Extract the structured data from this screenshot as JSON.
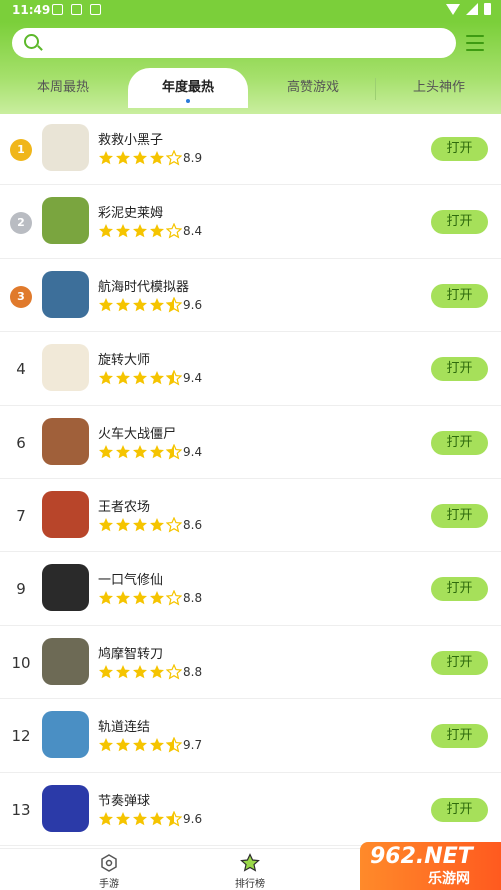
{
  "status_bar": {
    "time": "11:49"
  },
  "search": {
    "placeholder": "",
    "value": ""
  },
  "tabs": [
    {
      "label": "本周最热",
      "active": false
    },
    {
      "label": "年度最热",
      "active": true
    },
    {
      "label": "高赞游戏",
      "active": false
    },
    {
      "label": "上头神作",
      "active": false
    }
  ],
  "games": [
    {
      "rank": "1",
      "medal": "gold",
      "name": "救救小黑子",
      "score": "8.9",
      "stars": 4,
      "button": "打开",
      "icon_color": "#e9e4d6"
    },
    {
      "rank": "2",
      "medal": "silver",
      "name": "彩泥史莱姆",
      "score": "8.4",
      "stars": 4,
      "button": "打开",
      "icon_color": "#7aa53f"
    },
    {
      "rank": "3",
      "medal": "bronze",
      "name": "航海时代模拟器",
      "score": "9.6",
      "stars": 4.5,
      "button": "打开",
      "icon_color": "#3d6f9a"
    },
    {
      "rank": "4",
      "medal": "",
      "name": "旋转大师",
      "score": "9.4",
      "stars": 4.5,
      "button": "打开",
      "icon_color": "#f1e9d8"
    },
    {
      "rank": "6",
      "medal": "",
      "name": "火车大战僵尸",
      "score": "9.4",
      "stars": 4.5,
      "button": "打开",
      "icon_color": "#a0603a"
    },
    {
      "rank": "7",
      "medal": "",
      "name": "王者农场",
      "score": "8.6",
      "stars": 4,
      "button": "打开",
      "icon_color": "#b8452a"
    },
    {
      "rank": "9",
      "medal": "",
      "name": "一口气修仙",
      "score": "8.8",
      "stars": 4,
      "button": "打开",
      "icon_color": "#2a2a2a"
    },
    {
      "rank": "10",
      "medal": "",
      "name": "鸠摩智转刀",
      "score": "8.8",
      "stars": 4,
      "button": "打开",
      "icon_color": "#6d6a55"
    },
    {
      "rank": "12",
      "medal": "",
      "name": "轨道连结",
      "score": "9.7",
      "stars": 4.5,
      "button": "打开",
      "icon_color": "#4a8fc4"
    },
    {
      "rank": "13",
      "medal": "",
      "name": "节奏弹球",
      "score": "9.6",
      "stars": 4.5,
      "button": "打开",
      "icon_color": "#2b3aa8"
    }
  ],
  "bottom_nav": [
    {
      "label": "手游",
      "icon": "gamepad-icon",
      "active": false
    },
    {
      "label": "排行榜",
      "icon": "star-icon",
      "active": true
    }
  ],
  "watermark": {
    "main": "962.NET",
    "sub": "乐游网"
  },
  "colors": {
    "accent": "#7bcf3a",
    "button_bg": "#a6e05a",
    "star": "#f5c400"
  }
}
